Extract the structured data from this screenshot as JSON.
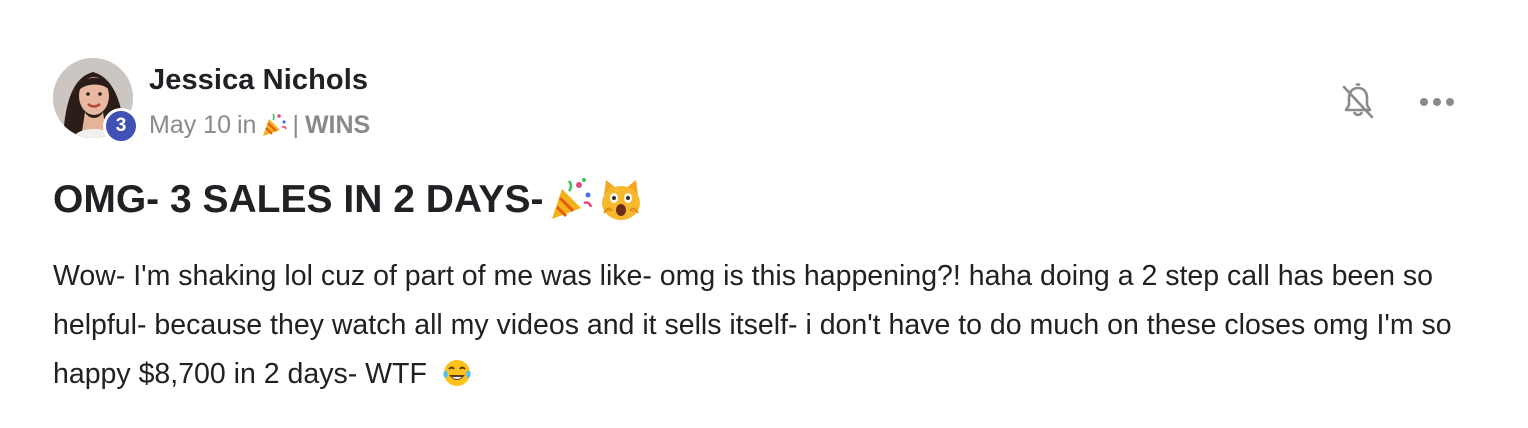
{
  "post": {
    "author": {
      "name": "Jessica Nichols",
      "level": "3"
    },
    "meta": {
      "date": "May 10",
      "in_text": "in",
      "category_emoji": "party-popper",
      "separator": "|",
      "category": "WINS"
    },
    "actions": {
      "bell_icon": "bell-off-icon",
      "more_icon": "more-horizontal-icon"
    },
    "title": {
      "text": "OMG- 3 SALES IN 2 DAYS-",
      "emojis": [
        "party-popper",
        "weary-cat"
      ]
    },
    "body": {
      "text": "Wow- I'm shaking lol cuz of part of me was like- omg is this happening?! haha doing a 2 step call has been so helpful- because they watch all my videos and it sells itself- i don't have to do much on these closes omg I'm so happy $8,700 in 2 days- WTF",
      "trailing_emoji": "tears-of-joy"
    },
    "colors": {
      "text": "#202124",
      "muted": "#8a8a8a",
      "badge": "#3f51b5",
      "background": "#ffffff"
    }
  }
}
